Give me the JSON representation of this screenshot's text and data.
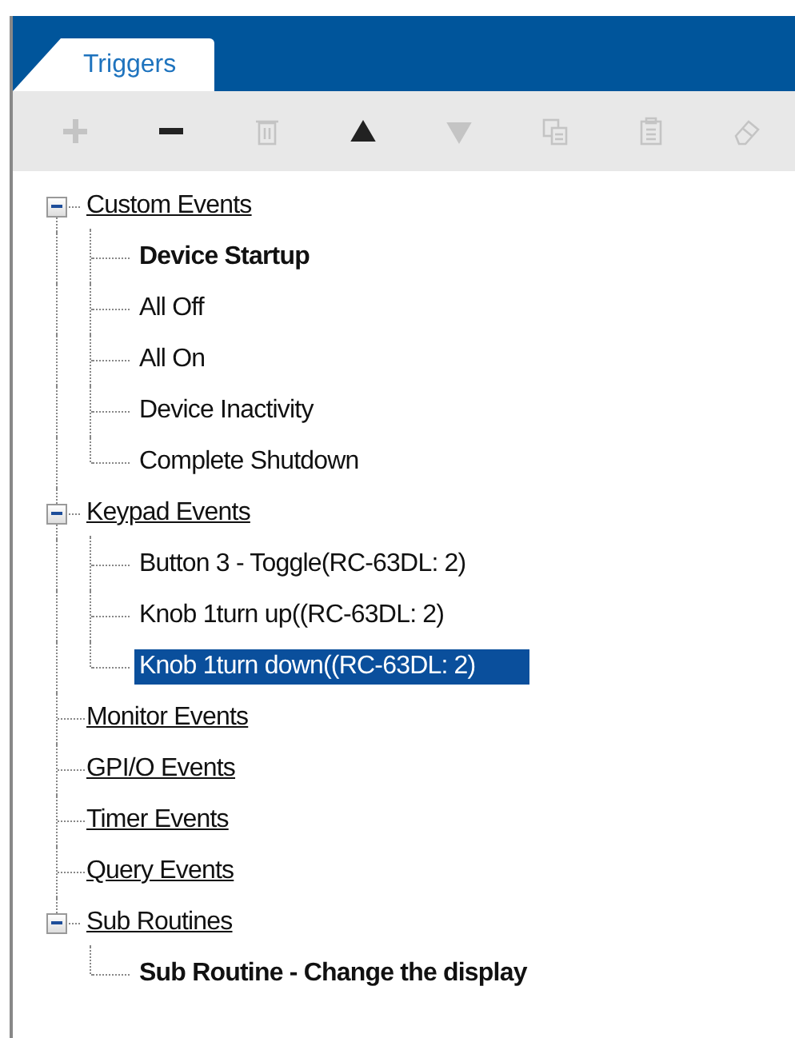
{
  "tabs": [
    {
      "label": "Triggers",
      "selected": true
    }
  ],
  "toolbar": [
    {
      "kind": "add",
      "disabled": true
    },
    {
      "kind": "remove",
      "disabled": false
    },
    {
      "kind": "delete",
      "disabled": true
    },
    {
      "kind": "up",
      "disabled": false
    },
    {
      "kind": "down",
      "disabled": true
    },
    {
      "kind": "copy",
      "disabled": true
    },
    {
      "kind": "paste",
      "disabled": true
    },
    {
      "kind": "erase",
      "disabled": true
    }
  ],
  "tree": [
    {
      "label": "Custom Events",
      "expanded": true,
      "children": [
        {
          "label": "Device Startup",
          "bold": true,
          "selected": false
        },
        {
          "label": "All Off",
          "bold": false,
          "selected": false
        },
        {
          "label": "All On",
          "bold": false,
          "selected": false
        },
        {
          "label": "Device Inactivity",
          "bold": false,
          "selected": false
        },
        {
          "label": "Complete Shutdown",
          "bold": false,
          "selected": false
        }
      ]
    },
    {
      "label": "Keypad Events",
      "expanded": true,
      "children": [
        {
          "label": "Button 3 - Toggle(RC-63DL: 2)",
          "bold": false,
          "selected": false
        },
        {
          "label": "Knob 1turn up((RC-63DL: 2)",
          "bold": false,
          "selected": false
        },
        {
          "label": "Knob 1turn down((RC-63DL: 2)",
          "bold": false,
          "selected": true
        }
      ]
    },
    {
      "label": "Monitor Events",
      "expanded": false
    },
    {
      "label": "GPI/O Events",
      "expanded": false
    },
    {
      "label": "Timer Events",
      "expanded": false
    },
    {
      "label": "Query Events",
      "expanded": false
    },
    {
      "label": "Sub Routines",
      "expanded": true,
      "children": [
        {
          "label": "Sub Routine - Change the display",
          "bold": true,
          "selected": false
        }
      ]
    }
  ]
}
